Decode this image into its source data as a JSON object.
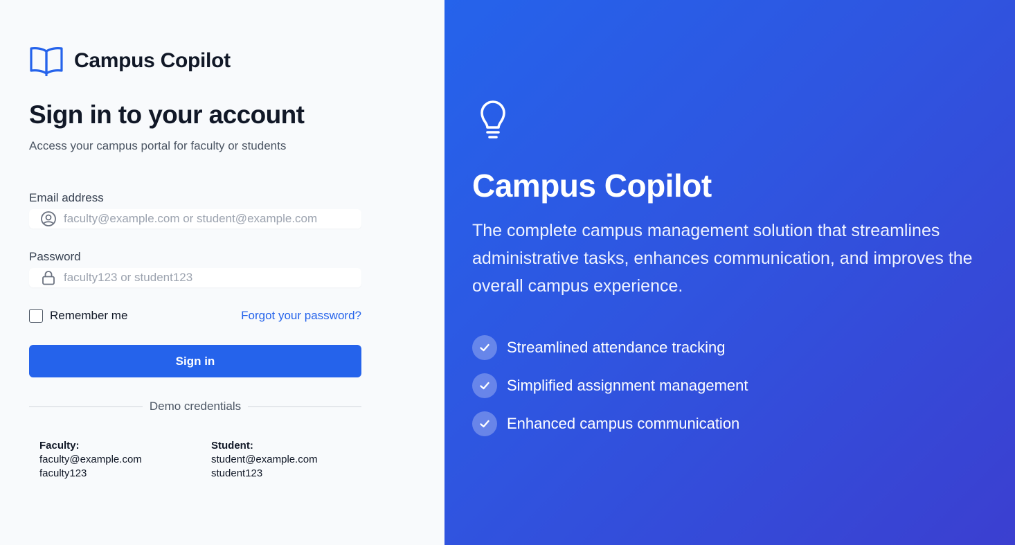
{
  "brand": {
    "name": "Campus Copilot",
    "icon": "book-open-icon",
    "accent_color": "#2563eb"
  },
  "form": {
    "heading": "Sign in to your account",
    "subheading": "Access your campus portal for faculty or students",
    "email_label": "Email address",
    "email_placeholder": "faculty@example.com or student@example.com",
    "email_value": "",
    "password_label": "Password",
    "password_placeholder": "faculty123 or student123",
    "password_value": "",
    "remember_label": "Remember me",
    "remember_checked": false,
    "forgot_link": "Forgot your password?",
    "submit_label": "Sign in"
  },
  "demo": {
    "divider_label": "Demo credentials",
    "faculty": {
      "title": "Faculty:",
      "email": "faculty@example.com",
      "password": "faculty123"
    },
    "student": {
      "title": "Student:",
      "email": "student@example.com",
      "password": "student123"
    }
  },
  "promo": {
    "icon": "lightbulb-icon",
    "title": "Campus Copilot",
    "description": "The complete campus management solution that streamlines administrative tasks, enhances communication, and improves the overall campus experience.",
    "features": [
      "Streamlined attendance tracking",
      "Simplified assignment management",
      "Enhanced campus communication"
    ],
    "gradient_start": "#2563eb",
    "gradient_end": "#3b3fd0"
  }
}
